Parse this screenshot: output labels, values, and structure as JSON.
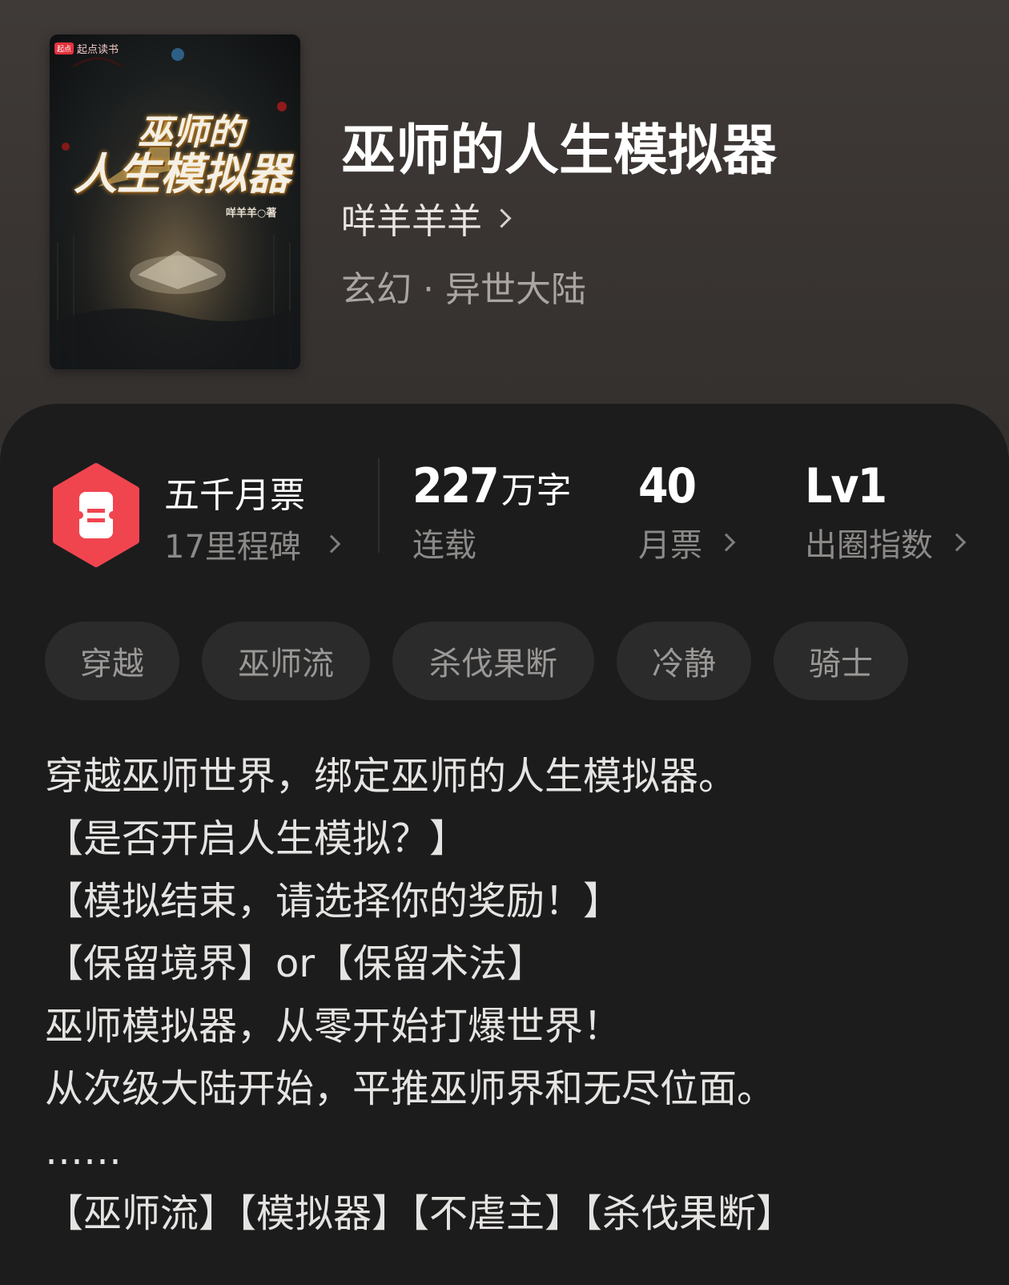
{
  "book": {
    "title": "巫师的人生模拟器",
    "author": "咩羊羊羊",
    "genre": "玄幻 · 异世大陆"
  },
  "cover": {
    "brand": "起点读书",
    "brand_badge": "起点",
    "title_line1": "巫师的",
    "title_line2": "人生模拟器",
    "author_credit": "咩羊羊○著"
  },
  "stats": {
    "ticket_title": "五千月票",
    "ticket_sub": "17里程碑",
    "words_value": "227",
    "words_unit": "万字",
    "words_label": "连载",
    "monthly_value": "40",
    "monthly_label": "月票",
    "level_value": "Lv1",
    "level_label": "出圈指数"
  },
  "tags": [
    "穿越",
    "巫师流",
    "杀伐果断",
    "冷静",
    "骑士"
  ],
  "description": [
    "穿越巫师世界，绑定巫师的人生模拟器。",
    "【是否开启人生模拟？】",
    "【模拟结束，请选择你的奖励！】",
    "【保留境界】or【保留术法】",
    "巫师模拟器，从零开始打爆世界！",
    "从次级大陆开始，平推巫师界和无尽位面。",
    "……",
    "【巫师流】【模拟器】【不虐主】【杀伐果断】"
  ],
  "colors": {
    "ticket_red": "#f0454f",
    "card_bg": "#1c1c1c",
    "tag_bg": "#2b2b2b"
  }
}
